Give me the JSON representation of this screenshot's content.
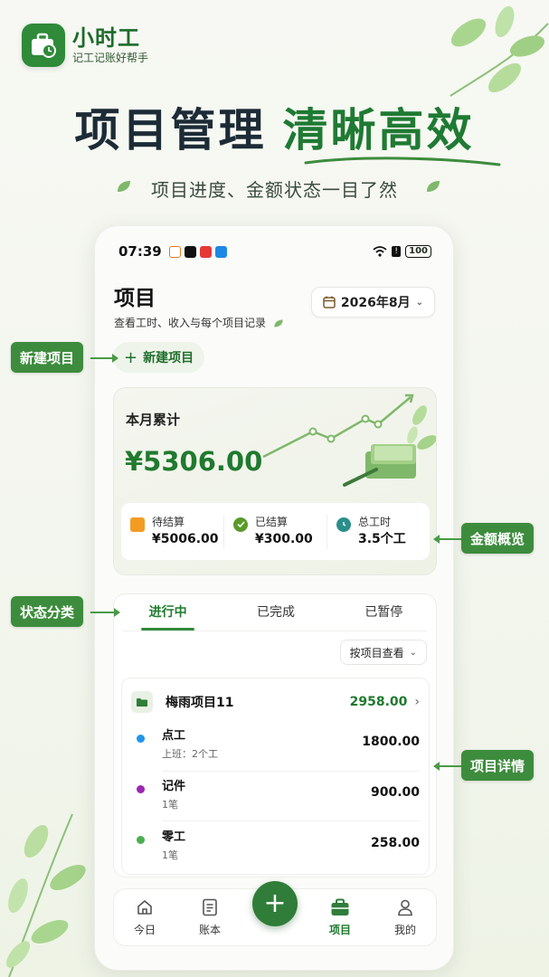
{
  "brand": {
    "name": "小时工",
    "slogan": "记工记账好帮手"
  },
  "headline": {
    "dark": "项目管理",
    "green": "清晰高效"
  },
  "subline": "项目进度、金额状态一目了然",
  "phone": {
    "status": {
      "time": "07:39",
      "battery": "100"
    },
    "page_title": "项目",
    "page_desc": "查看工时、收入与每个项目记录",
    "date_selector": "2026年8月",
    "new_project_button": "新建项目",
    "summary": {
      "title": "本月累计",
      "amount": "¥5306.00",
      "items": [
        {
          "label": "待结算",
          "value": "¥5006.00",
          "icon": "wallet-icon",
          "color": "#f29c24"
        },
        {
          "label": "已结算",
          "value": "¥300.00",
          "icon": "check-circle-icon",
          "color": "#5a9a2a"
        },
        {
          "label": "总工时",
          "value": "3.5个工",
          "icon": "clock-icon",
          "color": "#2a8f8a"
        }
      ]
    },
    "tabs": [
      {
        "label": "进行中",
        "active": true
      },
      {
        "label": "已完成",
        "active": false
      },
      {
        "label": "已暂停",
        "active": false
      }
    ],
    "view_selector": "按项目查看",
    "project": {
      "name": "梅雨项目11",
      "total": "2958.00",
      "entries": [
        {
          "name": "点工",
          "sub": "上班：2个工",
          "amount": "1800.00",
          "color": "#2196e6"
        },
        {
          "name": "记件",
          "sub": "1笔",
          "amount": "900.00",
          "color": "#9c27b0"
        },
        {
          "name": "零工",
          "sub": "1笔",
          "amount": "258.00",
          "color": "#4caf50"
        }
      ]
    },
    "nav": [
      {
        "label": "今日",
        "icon": "home-icon",
        "active": false
      },
      {
        "label": "账本",
        "icon": "ledger-icon",
        "active": false
      },
      {
        "label": "项目",
        "icon": "briefcase-icon",
        "active": true
      },
      {
        "label": "我的",
        "icon": "user-icon",
        "active": false
      }
    ],
    "fab_icon": "plus-icon"
  },
  "callouts": {
    "new_project": "新建项目",
    "amount_overview": "金额概览",
    "status_category": "状态分类",
    "project_detail": "项目详情"
  },
  "colors": {
    "primary": "#2f8a3a",
    "amount_green": "#1f7a2e",
    "callout": "#3d8c3d"
  }
}
